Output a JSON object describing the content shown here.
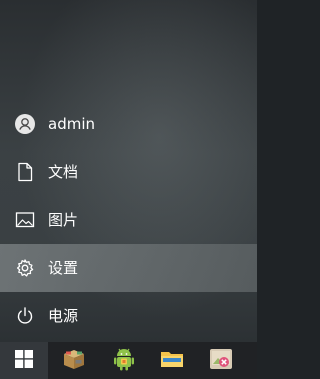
{
  "start_menu": {
    "items": [
      {
        "id": "user",
        "label": "admin",
        "icon": "user-avatar-icon"
      },
      {
        "id": "documents",
        "label": "文档",
        "icon": "document-icon"
      },
      {
        "id": "pictures",
        "label": "图片",
        "icon": "picture-icon"
      },
      {
        "id": "settings",
        "label": "设置",
        "icon": "gear-icon"
      },
      {
        "id": "power",
        "label": "电源",
        "icon": "power-icon"
      }
    ],
    "highlighted_item": "settings"
  },
  "taskbar": {
    "start_button_icon": "windows-logo-icon",
    "apps": [
      {
        "icon": "box-app-icon"
      },
      {
        "icon": "android-app-icon"
      },
      {
        "icon": "file-explorer-icon"
      },
      {
        "icon": "photo-app-icon"
      }
    ]
  }
}
